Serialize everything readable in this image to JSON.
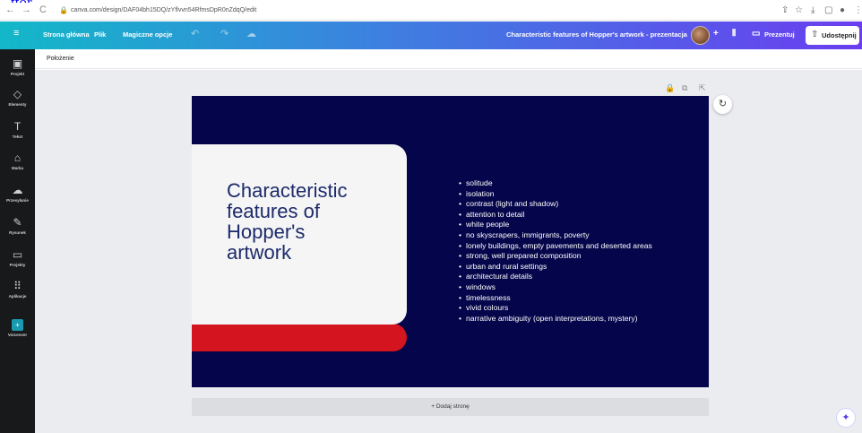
{
  "fragment": "ttor",
  "browser": {
    "back_icon": "←",
    "forward_icon": "→",
    "reload_icon": "C",
    "url": "canva.com/design/DAF04bh15DQ/zYflvvn54RfmsDpR0nZdqQ/edit"
  },
  "topbar": {
    "menu_icon": "≡",
    "home": "Strona główna",
    "file": "Plik",
    "magic": "Magiczne opcje",
    "undo_icon": "↶",
    "redo_icon": "↷",
    "cloud_icon": "☁",
    "title": "Characteristic features of Hopper's artwork - prezentacja",
    "add_icon": "+",
    "chart_icon": "⫴",
    "present": "Prezentuj",
    "share": "Udostępnij"
  },
  "sidebar": {
    "items": [
      {
        "icon": "▣",
        "label": "Projekt"
      },
      {
        "icon": "◇",
        "label": "Elementy"
      },
      {
        "icon": "T",
        "label": "Tekst"
      },
      {
        "icon": "⌂",
        "label": "Marka"
      },
      {
        "icon": "☁",
        "label": "Przesyłanie"
      },
      {
        "icon": "✎",
        "label": "Rysunek"
      },
      {
        "icon": "▭",
        "label": "Projekty"
      },
      {
        "icon": "⠿",
        "label": "Aplikacje"
      },
      {
        "icon": "+",
        "label": "Voiceover"
      }
    ]
  },
  "position_bar": {
    "label": "Położenie"
  },
  "slide": {
    "title_lines": [
      "Characteristic",
      "features of",
      "Hopper's",
      "artwork"
    ],
    "bullets": [
      "solitude",
      "isolation",
      "contrast (light and shadow)",
      "attention to detail",
      "white people",
      "no skyscrapers, immigrants, poverty",
      "lonely buildings, empty pavements and deserted areas",
      "strong, well prepared composition",
      "urban and rural settings",
      "architectural details",
      "windows",
      "timelessness",
      "vivid colours",
      "narrative ambiguity (open interpretations, mystery)"
    ],
    "colors": {
      "background": "#04054a",
      "card": "#f5f5f5",
      "accent": "#d41520",
      "title": "#1d2a6b"
    }
  },
  "add_page": "+ Dodaj stronę"
}
